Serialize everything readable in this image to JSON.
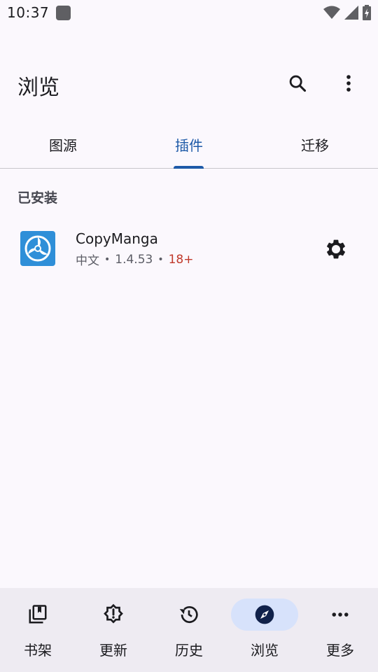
{
  "status_bar": {
    "time": "10:37",
    "icons": [
      "notification-icon",
      "wifi-icon",
      "signal-icon",
      "battery-icon"
    ]
  },
  "appbar": {
    "title": "浏览",
    "search_icon": "search-icon",
    "more_icon": "more-vert-icon"
  },
  "tabs": [
    {
      "label": "图源",
      "active": false
    },
    {
      "label": "插件",
      "active": true
    },
    {
      "label": "迁移",
      "active": false
    }
  ],
  "installed": {
    "header": "已安装",
    "items": [
      {
        "name": "CopyManga",
        "language": "中文",
        "version": "1.4.53",
        "nsfw": "18+",
        "settings_icon": "gear-icon"
      }
    ]
  },
  "bottom_nav": [
    {
      "label": "书架",
      "icon": "library-icon",
      "active": false
    },
    {
      "label": "更新",
      "icon": "updates-icon",
      "active": false
    },
    {
      "label": "历史",
      "icon": "history-icon",
      "active": false
    },
    {
      "label": "浏览",
      "icon": "explore-icon",
      "active": true
    },
    {
      "label": "更多",
      "icon": "more-horiz-icon",
      "active": false
    }
  ],
  "colors": {
    "background": "#fbf8fd",
    "accent": "#1e5aa8",
    "nav_background": "#eeebf2",
    "nav_active_pill": "#d7e2fb",
    "nsfw": "#c0392b"
  }
}
